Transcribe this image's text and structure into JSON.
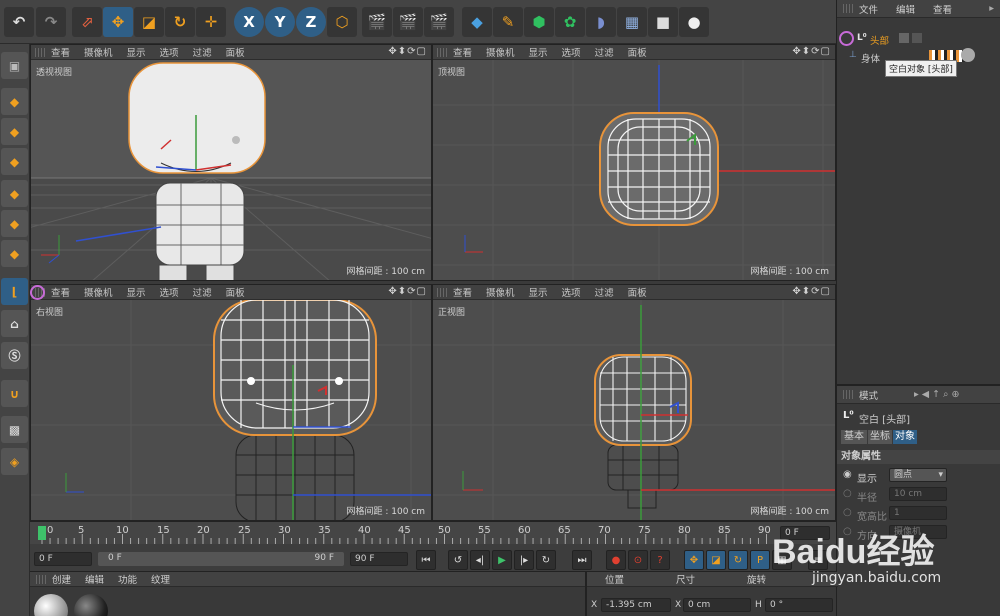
{
  "viewport_menu": [
    "查看",
    "摄像机",
    "显示",
    "选项",
    "过滤",
    "面板"
  ],
  "viewports": [
    {
      "label": "透视视图",
      "grid": "网格间距 : 100 cm"
    },
    {
      "label": "顶视图",
      "grid": "网格间距 : 100 cm"
    },
    {
      "label": "右视图",
      "grid": "网格间距 : 100 cm"
    },
    {
      "label": "正视图",
      "grid": "网格间距 : 100 cm"
    }
  ],
  "toolbar": {
    "axis_x": "X",
    "axis_y": "Y",
    "axis_z": "Z"
  },
  "object_manager": {
    "menu": [
      "文件",
      "编辑",
      "查看"
    ],
    "objects": [
      {
        "name": "头部",
        "icon": "null-object-icon"
      },
      {
        "name": "身体",
        "icon": "null-object-icon"
      }
    ],
    "tooltip": "空白对象 [头部]"
  },
  "attribute_manager": {
    "menu": "模式",
    "title": "空白 [头部]",
    "tabs": [
      "基本",
      "坐标",
      "对象"
    ],
    "section": "对象属性",
    "rows": [
      {
        "label": "显示",
        "value": "圆点"
      },
      {
        "label": "半径",
        "value": "10 cm"
      },
      {
        "label": "宽高比",
        "value": "1"
      },
      {
        "label": "方向",
        "value": "摄像机"
      }
    ]
  },
  "timeline": {
    "ticks": [
      "0",
      "5",
      "10",
      "15",
      "20",
      "25",
      "30",
      "35",
      "40",
      "45",
      "50",
      "55",
      "60",
      "65",
      "70",
      "75",
      "80",
      "85",
      "90"
    ],
    "current_frame": "0 F",
    "start": "0 F",
    "range_start": "0 F",
    "range_end": "90 F",
    "end": "90 F",
    "frame_field": "0 F"
  },
  "material_manager": {
    "menu": [
      "创建",
      "编辑",
      "功能",
      "纹理"
    ]
  },
  "coord_manager": {
    "headers": [
      "位置",
      "尺寸",
      "旋转"
    ],
    "x_label": "X",
    "x_pos": "-1.395 cm",
    "x_size": "0 cm",
    "h_label": "H",
    "h_rot": "0 °"
  },
  "watermark": {
    "logo": "Baidu经验",
    "url": "jingyan.baidu.com"
  },
  "colors": {
    "accent": "#2f5f87",
    "highlight": "#c86bd8",
    "orange": "#e8943a"
  }
}
